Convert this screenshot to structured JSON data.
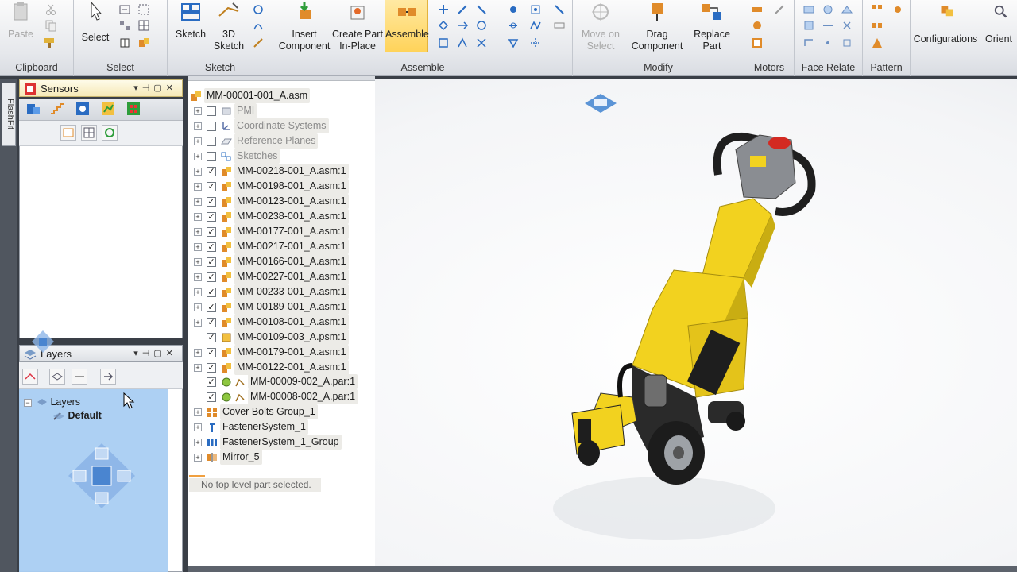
{
  "ribbon": {
    "clipboard": {
      "label": "Clipboard",
      "paste": "Paste"
    },
    "select": {
      "label": "Select",
      "button": "Select"
    },
    "sketch": {
      "label": "Sketch",
      "sketch_btn": "Sketch",
      "sketch3d_line1": "3D",
      "sketch3d_line2": "Sketch"
    },
    "assemble": {
      "label": "Assemble",
      "insert_line1": "Insert",
      "insert_line2": "Component",
      "create_line1": "Create Part",
      "create_line2": "In-Place",
      "assemble_btn": "Assemble"
    },
    "modify": {
      "label": "Modify",
      "move_line1": "Move on",
      "move_line2": "Select",
      "drag_line1": "Drag",
      "drag_line2": "Component",
      "replace_line1": "Replace",
      "replace_line2": "Part"
    },
    "motors": {
      "label": "Motors"
    },
    "face_relate": {
      "label": "Face Relate"
    },
    "pattern": {
      "label": "Pattern"
    },
    "configurations": {
      "label": "Configurations"
    },
    "orient": {
      "label": "Orient"
    }
  },
  "flashfit": "FlashFit",
  "sensors": {
    "title": "Sensors"
  },
  "layers": {
    "title": "Layers",
    "tree_root": "Layers",
    "tree_child": "Default"
  },
  "tree": {
    "root": "MM-00001-001_A.asm",
    "items": [
      {
        "label": "PMI",
        "checked": false,
        "grey": true
      },
      {
        "label": "Coordinate Systems",
        "checked": false,
        "grey": true
      },
      {
        "label": "Reference Planes",
        "checked": false,
        "grey": true
      },
      {
        "label": "Sketches",
        "checked": false,
        "grey": true
      },
      {
        "label": "MM-00218-001_A.asm:1",
        "checked": true
      },
      {
        "label": "MM-00198-001_A.asm:1",
        "checked": true
      },
      {
        "label": "MM-00123-001_A.asm:1",
        "checked": true
      },
      {
        "label": "MM-00238-001_A.asm:1",
        "checked": true
      },
      {
        "label": "MM-00177-001_A.asm:1",
        "checked": true
      },
      {
        "label": "MM-00217-001_A.asm:1",
        "checked": true
      },
      {
        "label": "MM-00166-001_A.asm:1",
        "checked": true
      },
      {
        "label": "MM-00227-001_A.asm:1",
        "checked": true
      },
      {
        "label": "MM-00233-001_A.asm:1",
        "checked": true
      },
      {
        "label": "MM-00189-001_A.asm:1",
        "checked": true
      },
      {
        "label": "MM-00108-001_A.asm:1",
        "checked": true
      },
      {
        "label": "MM-00109-003_A.psm:1",
        "checked": true
      },
      {
        "label": "MM-00179-001_A.asm:1",
        "checked": true
      },
      {
        "label": "MM-00122-001_A.asm:1",
        "checked": true
      },
      {
        "label": "MM-00009-002_A.par:1",
        "checked": true
      },
      {
        "label": "MM-00008-002_A.par:1",
        "checked": true
      }
    ],
    "groups": [
      {
        "label": "Cover Bolts Group_1"
      },
      {
        "label": "FastenerSystem_1"
      },
      {
        "label": "FastenerSystem_1_Group"
      },
      {
        "label": "Mirror_5"
      }
    ],
    "status": "No top level part selected."
  },
  "colors": {
    "accent": "#ffd35a",
    "selection": "#a9cdf2",
    "machine_yellow": "#f2d21f"
  }
}
